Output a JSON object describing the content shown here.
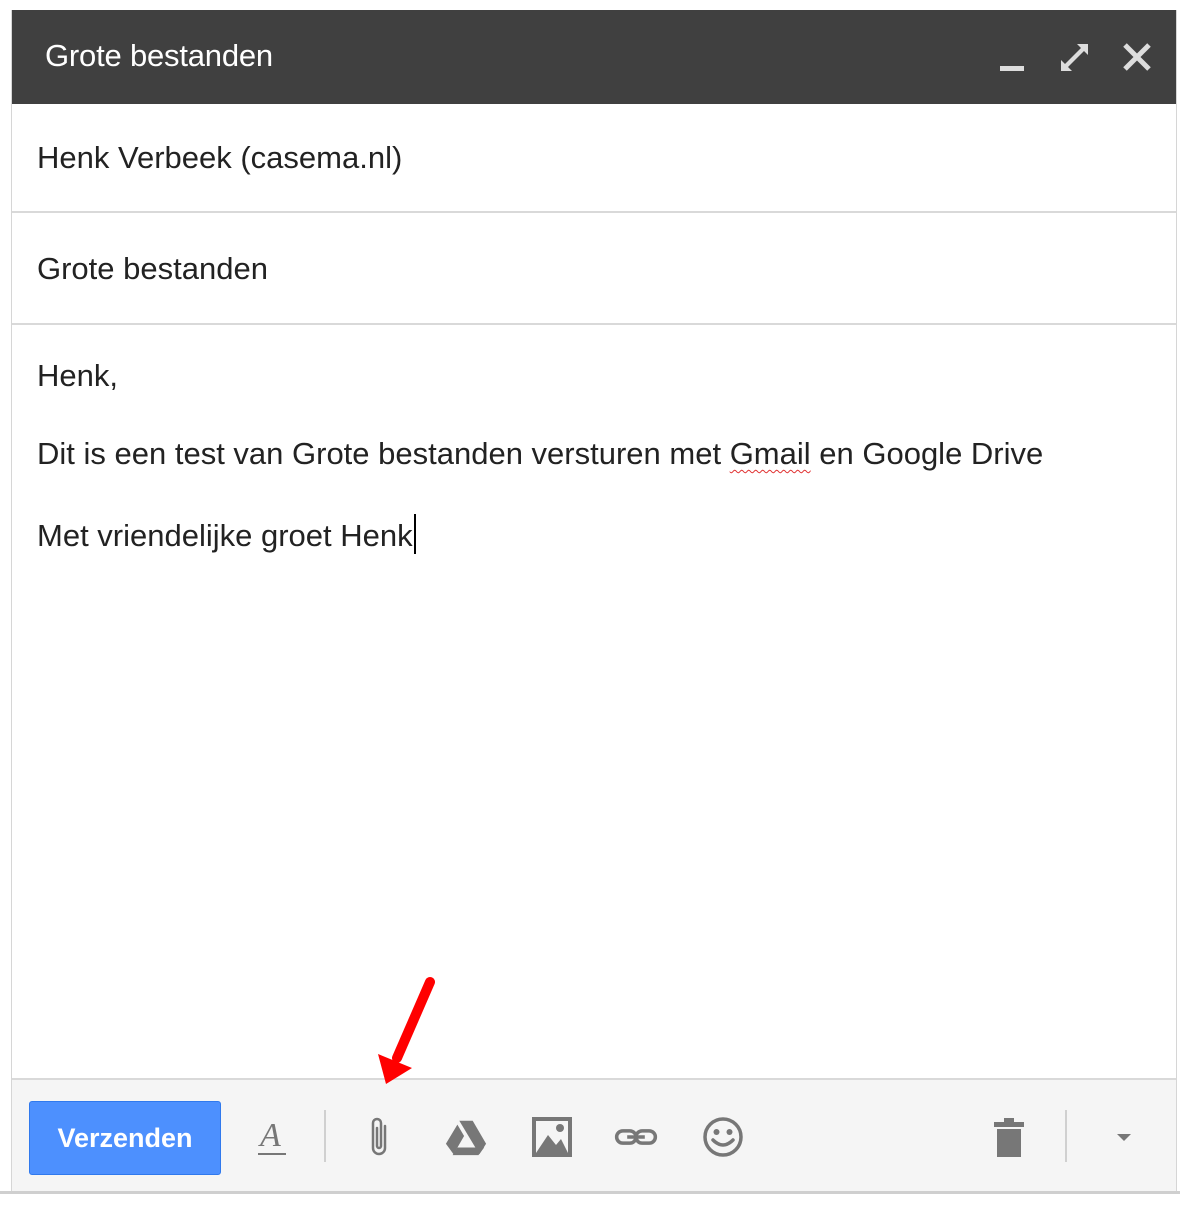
{
  "window": {
    "title": "Grote bestanden",
    "controls": [
      "minimize-icon",
      "expand-icon",
      "close-icon"
    ]
  },
  "compose": {
    "to": "Henk Verbeek (casema.nl)",
    "subject": "Grote bestanden",
    "body": {
      "greeting": "Henk,",
      "line_before": "Dit is een test van Grote bestanden versturen met ",
      "misspelled": "Gmail",
      "line_after": " en Google Drive",
      "closing": "Met vriendelijke groet Henk"
    }
  },
  "toolbar": {
    "send_label": "Verzenden",
    "tools": [
      "formatting-icon",
      "attach-icon",
      "drive-icon",
      "image-icon",
      "link-icon",
      "emoji-icon",
      "trash-icon",
      "more-options-icon"
    ]
  },
  "colors": {
    "titlebar": "#404040",
    "send_button": "#4d90fe",
    "annotation_arrow": "#ff0000"
  }
}
